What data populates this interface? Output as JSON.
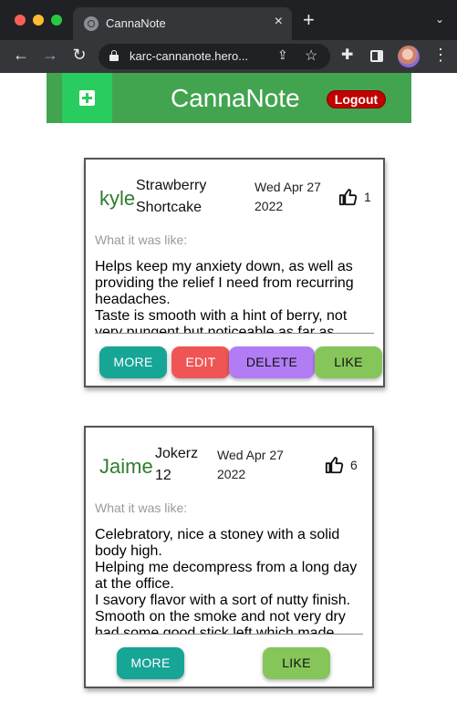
{
  "browser": {
    "tab_title": "CannaNote",
    "tab_close": "×",
    "new_tab": "+",
    "tab_menu": "⌄",
    "url": "karc-cannanote.hero...",
    "icons": [
      "back-arrow-icon",
      "forward-arrow-icon",
      "reload-icon",
      "lock-icon",
      "share-icon",
      "star-icon",
      "puzzle-icon",
      "side-panel-icon",
      "profile-avatar",
      "kebab-menu-icon"
    ]
  },
  "header": {
    "title": "CannaNote",
    "logout_label": "Logout",
    "add_icon": "plus-square-icon",
    "color": "#43a450",
    "add_color": "#29cc5e"
  },
  "notes": [
    {
      "author": "kyle",
      "strain": "Strawberry Shortcake",
      "date": "Wed Apr 27 2022",
      "likes": "1",
      "label": "What it was like:",
      "text": "Helps keep my anxiety down, as well as providing the relief I need from recurring headaches.\nTaste is smooth with a hint of berry, not very pungent but noticeable as far as",
      "buttons": {
        "more": "MORE",
        "edit": "EDIT",
        "delete": "DELETE",
        "like": "LIKE"
      }
    },
    {
      "author": "Jaime",
      "strain": "Jokerz 12",
      "date": "Wed Apr 27 2022",
      "likes": "6",
      "label": "What it was like:",
      "text": "Celebratory, nice a stoney with a solid body high.\nHelping me decompress from a long day at the office.\nI savory flavor with a sort of nutty finish. Smooth on the smoke and not very dry had some good stick left which made",
      "buttons": {
        "more": "MORE",
        "like": "LIKE"
      }
    }
  ],
  "colors": {
    "more": "#17a596",
    "edit": "#f05555",
    "delete": "#b27cf5",
    "like": "#86c55a",
    "author": "#2f7d2f",
    "logout": "#c10000"
  }
}
